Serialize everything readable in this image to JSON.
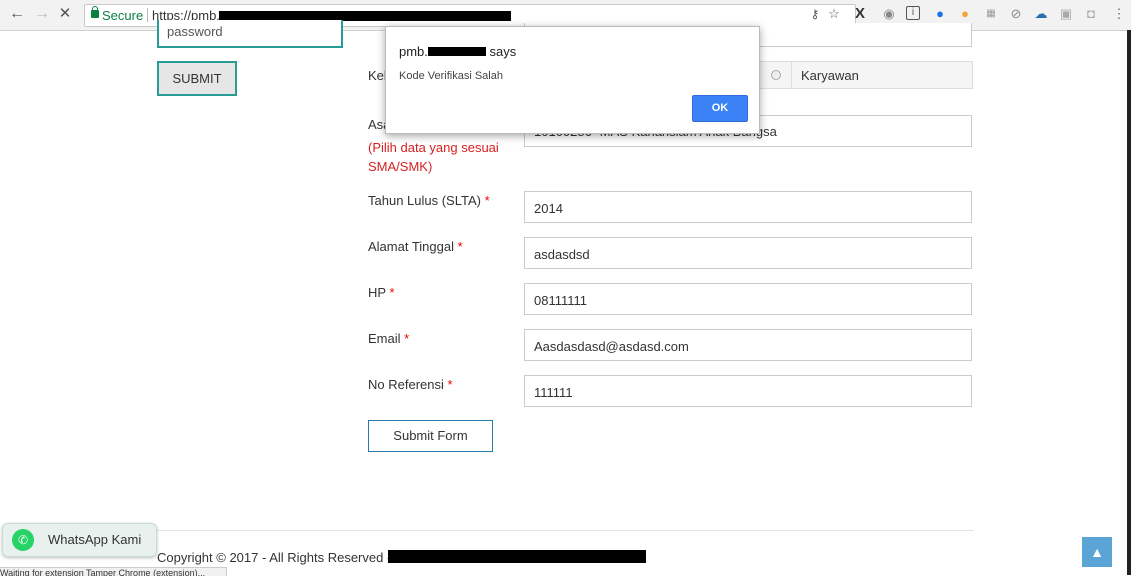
{
  "browser": {
    "secure_label": "Secure",
    "url_prefix": "https://pmb.",
    "nav": {
      "back": "←",
      "forward": "→",
      "stop": "✕"
    }
  },
  "login": {
    "password_placeholder": "password",
    "submit_label": "SUBMIT"
  },
  "form": {
    "kel_label_partial": "Kel",
    "asal_label_partial": "Asa",
    "school_value_partial": "10100286 -MAS Kanarisiam Anak Bangsa",
    "hint": "(Pilih data yang sesuai SMA/SMK)",
    "radio_option": "Karyawan",
    "fields": [
      {
        "label": "Tahun Lulus (SLTA)",
        "value": "2014"
      },
      {
        "label": "Alamat Tinggal",
        "value": "asdasdsd"
      },
      {
        "label": "HP",
        "value": "08111111"
      },
      {
        "label": "Email",
        "value": "Aasdasdasd@asdasd.com"
      },
      {
        "label": "No Referensi",
        "value": "111111"
      }
    ],
    "required_mark": "*",
    "submit_label": "Submit Form"
  },
  "dialog": {
    "origin_prefix": "pmb.",
    "origin_suffix": "says",
    "message": "Kode Verifikasi Salah",
    "ok_label": "OK"
  },
  "footer": {
    "copyright": "Copyright © 2017 - All Rights Reserved -",
    "whatsapp_label": "WhatsApp Kami",
    "status_text": "Waiting for extension Tamper Chrome (extension)..."
  },
  "colors": {
    "accent": "#2a9c98",
    "ok_button": "#3b82f6",
    "required": "#e00000",
    "hint": "#d92020"
  }
}
